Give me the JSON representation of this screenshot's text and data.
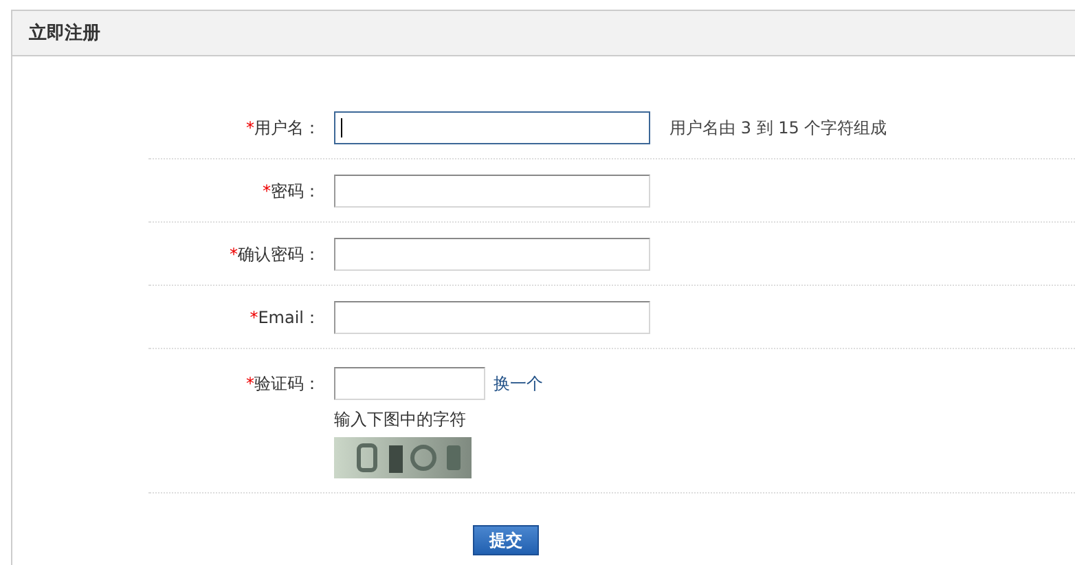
{
  "panel": {
    "title": "立即注册"
  },
  "fields": [
    {
      "kind": "text",
      "asterisk": "*",
      "label": "用户名：",
      "focused": true,
      "hint": "用户名由 3 到 15 个字符组成"
    },
    {
      "kind": "text",
      "asterisk": "*",
      "label": "密码：",
      "focused": false
    },
    {
      "kind": "text",
      "asterisk": "*",
      "label": "确认密码：",
      "focused": false
    },
    {
      "kind": "text",
      "asterisk": "*",
      "label": "Email：",
      "focused": false
    },
    {
      "kind": "captcha",
      "asterisk": "*",
      "label": "验证码：",
      "focused": false,
      "refresh_link": "换一个",
      "instruction": "输入下图中的字符"
    }
  ],
  "submit_button": "提交"
}
